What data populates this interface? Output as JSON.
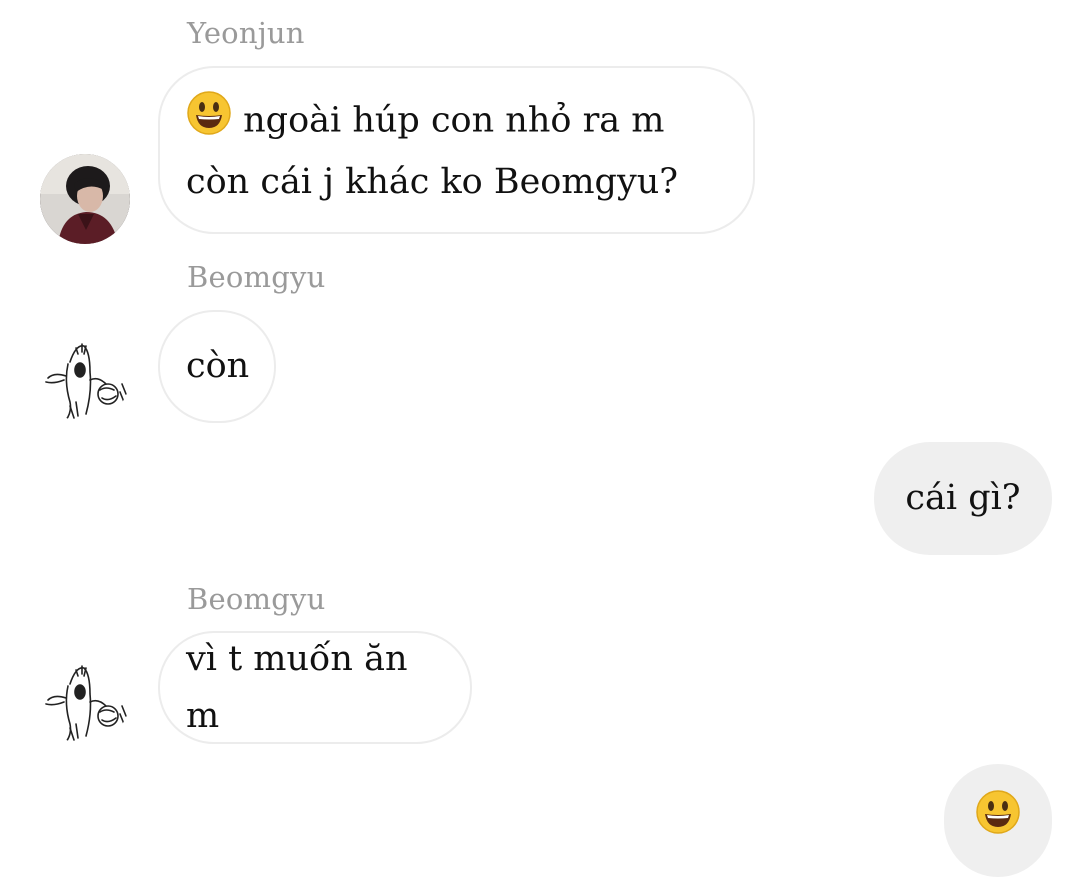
{
  "messages": [
    {
      "sender": "Yeonjun",
      "line1_emoji": "😃",
      "line1_text": "ngoài húp con nhỏ ra m",
      "line2_text": "còn cái j khác ko Beomgyu?"
    },
    {
      "sender": "Beomgyu",
      "text": "còn"
    },
    {
      "own_text": "cái gì?"
    },
    {
      "sender": "Beomgyu",
      "text": "vì t muốn ăn m"
    },
    {
      "own_emoji": "😃"
    }
  ],
  "colors": {
    "incoming_bubble_bg": "#ffffff",
    "incoming_bubble_border": "#ececec",
    "outgoing_bubble_bg": "#efefef",
    "sender_name": "#9a9a9a",
    "emoji_face": "#f7c531"
  },
  "icons": {
    "yeonjun_avatar": "photo-avatar",
    "beomgyu_avatar": "sketch-figure-avatar",
    "emoji": "grinning-face-icon"
  }
}
